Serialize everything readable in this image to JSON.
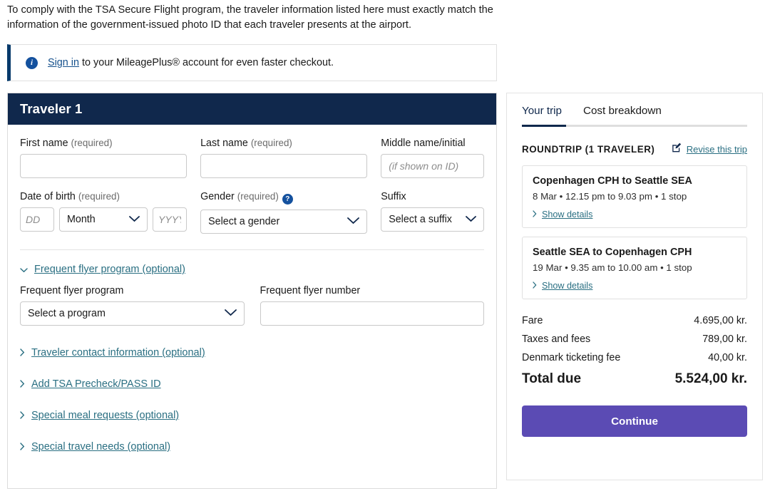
{
  "intro": {
    "text": "To comply with the TSA Secure Flight program, the traveler information listed here must exactly match the information of the government-issued photo ID that each traveler presents at the airport."
  },
  "signin_banner": {
    "icon": "info-icon",
    "link_label": "Sign in",
    "rest_text": " to your MileagePlus® account for even faster checkout."
  },
  "traveler_form": {
    "header_title": "Traveler 1",
    "first_name": {
      "label": "First name",
      "required_note": "(required)",
      "value": "",
      "placeholder": ""
    },
    "last_name": {
      "label": "Last name",
      "required_note": "(required)",
      "value": "",
      "placeholder": ""
    },
    "middle_name": {
      "label": "Middle name/initial",
      "value": "",
      "placeholder": "(if shown on ID)"
    },
    "date_of_birth": {
      "label": "Date of birth",
      "required_note": "(required)",
      "day_placeholder": "DD",
      "day_value": "",
      "month_value": "Month",
      "year_placeholder": "YYYY",
      "year_value": ""
    },
    "gender": {
      "label": "Gender",
      "required_note": "(required)",
      "help_icon": "question-mark-icon",
      "value": "Select a gender"
    },
    "suffix": {
      "label": "Suffix",
      "value": "Select a suffix"
    },
    "frequent_flyer": {
      "toggle_label": "Frequent flyer program (optional)",
      "toggle_caret": "chevron-down-icon",
      "program_label": "Frequent flyer program",
      "program_value": "Select a program",
      "number_label": "Frequent flyer number",
      "number_value": "",
      "number_placeholder": ""
    },
    "accordions": [
      {
        "label": "Traveler contact information (optional)",
        "caret": "chevron-right-icon"
      },
      {
        "label": "Add TSA Precheck/PASS ID",
        "caret": "chevron-right-icon"
      },
      {
        "label": "Special meal requests (optional)",
        "caret": "chevron-right-icon"
      },
      {
        "label": "Special travel needs (optional)",
        "caret": "chevron-right-icon"
      }
    ]
  },
  "sidebar": {
    "tabs": [
      {
        "label": "Your trip",
        "active": true
      },
      {
        "label": "Cost breakdown",
        "active": false
      }
    ],
    "trip_summary_title": "ROUNDTRIP (1 TRAVELER)",
    "revise": {
      "icon": "edit-pencil-icon",
      "label": "Revise this trip"
    },
    "flights": [
      {
        "title": "Copenhagen CPH to Seattle SEA",
        "meta": "8 Mar • 12.15 pm to 9.03 pm • 1 stop",
        "details_label": "Show details",
        "details_caret": "chevron-right-icon"
      },
      {
        "title": "Seattle SEA to Copenhagen CPH",
        "meta": "19 Mar • 9.35 am to 10.00 am • 1 stop",
        "details_label": "Show details",
        "details_caret": "chevron-right-icon"
      }
    ],
    "fares": [
      {
        "label": "Fare",
        "amount": "4.695,00 kr."
      },
      {
        "label": "Taxes and fees",
        "amount": "789,00 kr."
      },
      {
        "label": "Denmark ticketing fee",
        "amount": "40,00 kr."
      }
    ],
    "total": {
      "label": "Total due",
      "amount": "5.524,00 kr."
    },
    "continue_label": "Continue"
  },
  "colors": {
    "header_navy": "#10284c",
    "link_teal": "#2a6f82",
    "info_blue": "#14519e",
    "continue_purple": "#5b4bb4",
    "banner_accent": "#063a6b"
  }
}
